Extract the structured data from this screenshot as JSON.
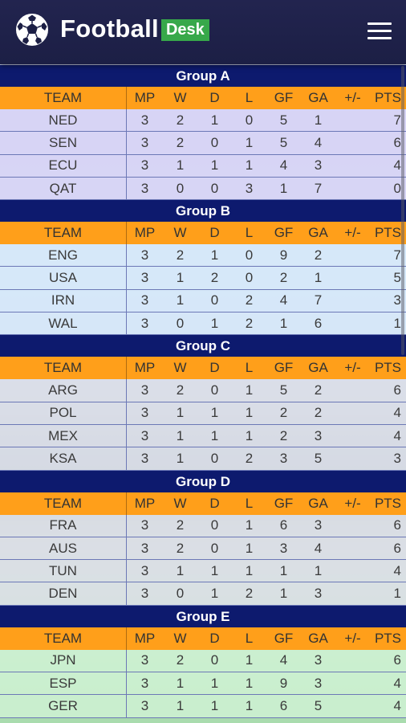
{
  "header": {
    "brand_main": "Football",
    "brand_badge": "Desk",
    "accent_green": "#37a84a",
    "bar_color": "#1c1f45"
  },
  "table": {
    "columns": [
      "TEAM",
      "MP",
      "W",
      "D",
      "L",
      "GF",
      "GA",
      "+/-",
      "PTS"
    ],
    "header_color": "#ff9f1a",
    "group_color": "#0d1a6e"
  },
  "groups": [
    {
      "title": "Group A",
      "rows": [
        [
          "NED",
          "3",
          "2",
          "1",
          "0",
          "5",
          "1",
          "",
          "7"
        ],
        [
          "SEN",
          "3",
          "2",
          "0",
          "1",
          "5",
          "4",
          "",
          "6"
        ],
        [
          "ECU",
          "3",
          "1",
          "1",
          "1",
          "4",
          "3",
          "",
          "4"
        ],
        [
          "QAT",
          "3",
          "0",
          "0",
          "3",
          "1",
          "7",
          "",
          "0"
        ]
      ]
    },
    {
      "title": "Group B",
      "rows": [
        [
          "ENG",
          "3",
          "2",
          "1",
          "0",
          "9",
          "2",
          "",
          "7"
        ],
        [
          "USA",
          "3",
          "1",
          "2",
          "0",
          "2",
          "1",
          "",
          "5"
        ],
        [
          "IRN",
          "3",
          "1",
          "0",
          "2",
          "4",
          "7",
          "",
          "3"
        ],
        [
          "WAL",
          "3",
          "0",
          "1",
          "2",
          "1",
          "6",
          "",
          "1"
        ]
      ]
    },
    {
      "title": "Group C",
      "rows": [
        [
          "ARG",
          "3",
          "2",
          "0",
          "1",
          "5",
          "2",
          "",
          "6"
        ],
        [
          "POL",
          "3",
          "1",
          "1",
          "1",
          "2",
          "2",
          "",
          "4"
        ],
        [
          "MEX",
          "3",
          "1",
          "1",
          "1",
          "2",
          "3",
          "",
          "4"
        ],
        [
          "KSA",
          "3",
          "1",
          "0",
          "2",
          "3",
          "5",
          "",
          "3"
        ]
      ]
    },
    {
      "title": "Group D",
      "rows": [
        [
          "FRA",
          "3",
          "2",
          "0",
          "1",
          "6",
          "3",
          "",
          "6"
        ],
        [
          "AUS",
          "3",
          "2",
          "0",
          "1",
          "3",
          "4",
          "",
          "6"
        ],
        [
          "TUN",
          "3",
          "1",
          "1",
          "1",
          "1",
          "1",
          "",
          "4"
        ],
        [
          "DEN",
          "3",
          "0",
          "1",
          "2",
          "1",
          "3",
          "",
          "1"
        ]
      ]
    },
    {
      "title": "Group E",
      "rows": [
        [
          "JPN",
          "3",
          "2",
          "0",
          "1",
          "4",
          "3",
          "",
          "6"
        ],
        [
          "ESP",
          "3",
          "1",
          "1",
          "1",
          "9",
          "3",
          "",
          "4"
        ],
        [
          "GER",
          "3",
          "1",
          "1",
          "1",
          "6",
          "5",
          "",
          "4"
        ]
      ]
    }
  ]
}
